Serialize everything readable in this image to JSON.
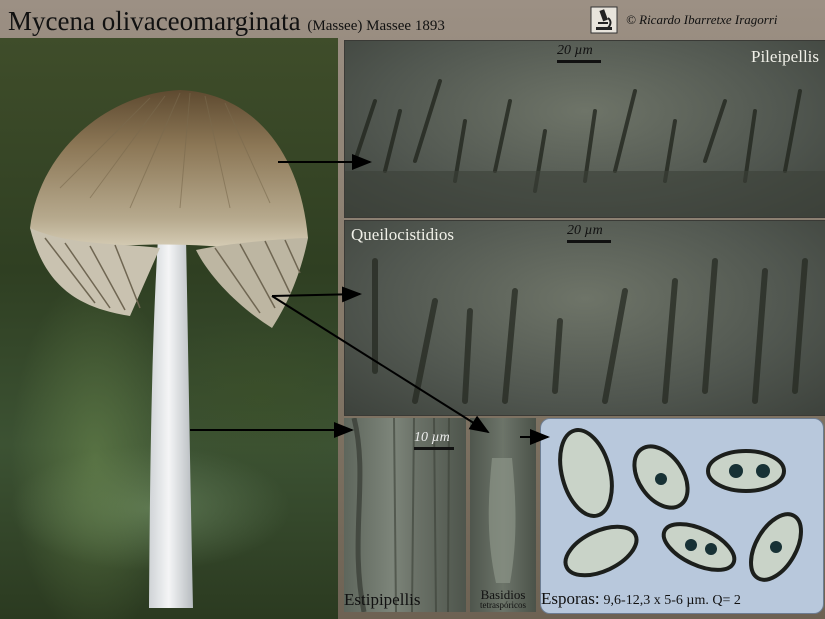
{
  "header": {
    "species": "Mycena olivaceomarginata",
    "authority": "(Massee) Massee 1893",
    "credit": "© Ricardo Ibarretxe Iragorri"
  },
  "panels": {
    "pileipellis": {
      "label": "Pileipellis",
      "scale": "20 µm"
    },
    "queilocistidios": {
      "label": "Queilocistidios",
      "scale": "20 µm"
    },
    "estipipellis": {
      "label": "Estipipellis",
      "scale": "10 µm"
    },
    "basidios": {
      "label": "Basidios",
      "sublabel": "tetraspóricos"
    },
    "esporas": {
      "label": "Esporas:",
      "measure": "9,6-12,3 x 5-6 µm. Q= 2"
    }
  },
  "icons": [
    "microscope-icon"
  ]
}
